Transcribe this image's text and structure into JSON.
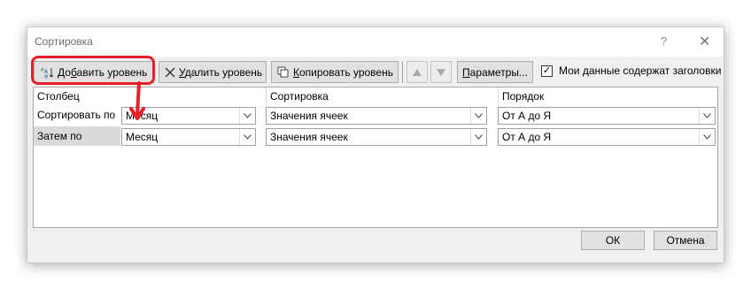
{
  "dialog": {
    "title": "Сортировка",
    "help": "?",
    "close": "✕"
  },
  "toolbar": {
    "add_level": {
      "prefix": "До",
      "ul": "б",
      "suffix": "авить уровень"
    },
    "delete_level": {
      "ul": "У",
      "suffix": "далить уровень"
    },
    "copy_level": {
      "ul": "К",
      "suffix": "опировать уровень"
    },
    "params": {
      "ul": "П",
      "suffix": "араметры..."
    },
    "header_checkbox_label": "Мои данные содержат заголовки",
    "header_checkbox_checked": true
  },
  "grid": {
    "headers": [
      "Столбец",
      "Сортировка",
      "Порядок"
    ],
    "rows": [
      {
        "label": "Сортировать по",
        "column": "Месяц",
        "sort_on": "Значения ячеек",
        "order": "От А до Я"
      },
      {
        "label": "Затем по",
        "column": "Месяц",
        "sort_on": "Значения ячеек",
        "order": "От А до Я"
      }
    ]
  },
  "footer": {
    "ok": "ОК",
    "cancel": "Отмена"
  },
  "colors": {
    "highlight": "#e8202a",
    "dialog_bg": "#f0f0f0"
  }
}
